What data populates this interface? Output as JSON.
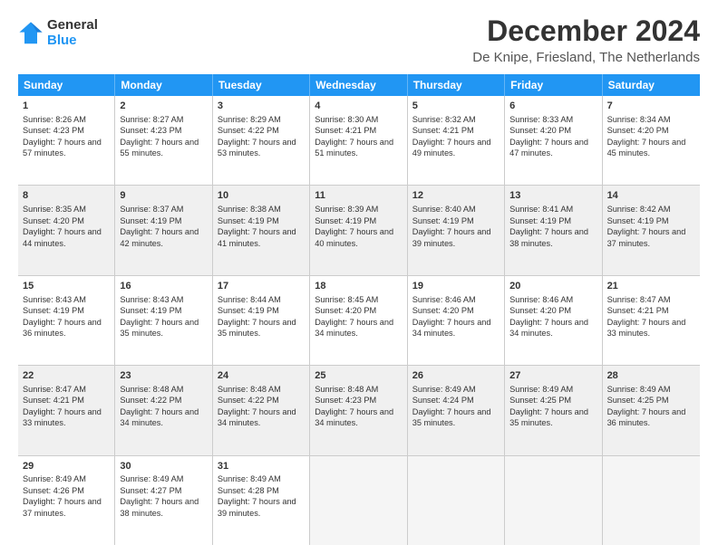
{
  "logo": {
    "general": "General",
    "blue": "Blue"
  },
  "title": "December 2024",
  "subtitle": "De Knipe, Friesland, The Netherlands",
  "days": [
    "Sunday",
    "Monday",
    "Tuesday",
    "Wednesday",
    "Thursday",
    "Friday",
    "Saturday"
  ],
  "weeks": [
    [
      {
        "day": 1,
        "sunrise": "Sunrise: 8:26 AM",
        "sunset": "Sunset: 4:23 PM",
        "daylight": "Daylight: 7 hours and 57 minutes."
      },
      {
        "day": 2,
        "sunrise": "Sunrise: 8:27 AM",
        "sunset": "Sunset: 4:23 PM",
        "daylight": "Daylight: 7 hours and 55 minutes."
      },
      {
        "day": 3,
        "sunrise": "Sunrise: 8:29 AM",
        "sunset": "Sunset: 4:22 PM",
        "daylight": "Daylight: 7 hours and 53 minutes."
      },
      {
        "day": 4,
        "sunrise": "Sunrise: 8:30 AM",
        "sunset": "Sunset: 4:21 PM",
        "daylight": "Daylight: 7 hours and 51 minutes."
      },
      {
        "day": 5,
        "sunrise": "Sunrise: 8:32 AM",
        "sunset": "Sunset: 4:21 PM",
        "daylight": "Daylight: 7 hours and 49 minutes."
      },
      {
        "day": 6,
        "sunrise": "Sunrise: 8:33 AM",
        "sunset": "Sunset: 4:20 PM",
        "daylight": "Daylight: 7 hours and 47 minutes."
      },
      {
        "day": 7,
        "sunrise": "Sunrise: 8:34 AM",
        "sunset": "Sunset: 4:20 PM",
        "daylight": "Daylight: 7 hours and 45 minutes."
      }
    ],
    [
      {
        "day": 8,
        "sunrise": "Sunrise: 8:35 AM",
        "sunset": "Sunset: 4:20 PM",
        "daylight": "Daylight: 7 hours and 44 minutes."
      },
      {
        "day": 9,
        "sunrise": "Sunrise: 8:37 AM",
        "sunset": "Sunset: 4:19 PM",
        "daylight": "Daylight: 7 hours and 42 minutes."
      },
      {
        "day": 10,
        "sunrise": "Sunrise: 8:38 AM",
        "sunset": "Sunset: 4:19 PM",
        "daylight": "Daylight: 7 hours and 41 minutes."
      },
      {
        "day": 11,
        "sunrise": "Sunrise: 8:39 AM",
        "sunset": "Sunset: 4:19 PM",
        "daylight": "Daylight: 7 hours and 40 minutes."
      },
      {
        "day": 12,
        "sunrise": "Sunrise: 8:40 AM",
        "sunset": "Sunset: 4:19 PM",
        "daylight": "Daylight: 7 hours and 39 minutes."
      },
      {
        "day": 13,
        "sunrise": "Sunrise: 8:41 AM",
        "sunset": "Sunset: 4:19 PM",
        "daylight": "Daylight: 7 hours and 38 minutes."
      },
      {
        "day": 14,
        "sunrise": "Sunrise: 8:42 AM",
        "sunset": "Sunset: 4:19 PM",
        "daylight": "Daylight: 7 hours and 37 minutes."
      }
    ],
    [
      {
        "day": 15,
        "sunrise": "Sunrise: 8:43 AM",
        "sunset": "Sunset: 4:19 PM",
        "daylight": "Daylight: 7 hours and 36 minutes."
      },
      {
        "day": 16,
        "sunrise": "Sunrise: 8:43 AM",
        "sunset": "Sunset: 4:19 PM",
        "daylight": "Daylight: 7 hours and 35 minutes."
      },
      {
        "day": 17,
        "sunrise": "Sunrise: 8:44 AM",
        "sunset": "Sunset: 4:19 PM",
        "daylight": "Daylight: 7 hours and 35 minutes."
      },
      {
        "day": 18,
        "sunrise": "Sunrise: 8:45 AM",
        "sunset": "Sunset: 4:20 PM",
        "daylight": "Daylight: 7 hours and 34 minutes."
      },
      {
        "day": 19,
        "sunrise": "Sunrise: 8:46 AM",
        "sunset": "Sunset: 4:20 PM",
        "daylight": "Daylight: 7 hours and 34 minutes."
      },
      {
        "day": 20,
        "sunrise": "Sunrise: 8:46 AM",
        "sunset": "Sunset: 4:20 PM",
        "daylight": "Daylight: 7 hours and 34 minutes."
      },
      {
        "day": 21,
        "sunrise": "Sunrise: 8:47 AM",
        "sunset": "Sunset: 4:21 PM",
        "daylight": "Daylight: 7 hours and 33 minutes."
      }
    ],
    [
      {
        "day": 22,
        "sunrise": "Sunrise: 8:47 AM",
        "sunset": "Sunset: 4:21 PM",
        "daylight": "Daylight: 7 hours and 33 minutes."
      },
      {
        "day": 23,
        "sunrise": "Sunrise: 8:48 AM",
        "sunset": "Sunset: 4:22 PM",
        "daylight": "Daylight: 7 hours and 34 minutes."
      },
      {
        "day": 24,
        "sunrise": "Sunrise: 8:48 AM",
        "sunset": "Sunset: 4:22 PM",
        "daylight": "Daylight: 7 hours and 34 minutes."
      },
      {
        "day": 25,
        "sunrise": "Sunrise: 8:48 AM",
        "sunset": "Sunset: 4:23 PM",
        "daylight": "Daylight: 7 hours and 34 minutes."
      },
      {
        "day": 26,
        "sunrise": "Sunrise: 8:49 AM",
        "sunset": "Sunset: 4:24 PM",
        "daylight": "Daylight: 7 hours and 35 minutes."
      },
      {
        "day": 27,
        "sunrise": "Sunrise: 8:49 AM",
        "sunset": "Sunset: 4:25 PM",
        "daylight": "Daylight: 7 hours and 35 minutes."
      },
      {
        "day": 28,
        "sunrise": "Sunrise: 8:49 AM",
        "sunset": "Sunset: 4:25 PM",
        "daylight": "Daylight: 7 hours and 36 minutes."
      }
    ],
    [
      {
        "day": 29,
        "sunrise": "Sunrise: 8:49 AM",
        "sunset": "Sunset: 4:26 PM",
        "daylight": "Daylight: 7 hours and 37 minutes."
      },
      {
        "day": 30,
        "sunrise": "Sunrise: 8:49 AM",
        "sunset": "Sunset: 4:27 PM",
        "daylight": "Daylight: 7 hours and 38 minutes."
      },
      {
        "day": 31,
        "sunrise": "Sunrise: 8:49 AM",
        "sunset": "Sunset: 4:28 PM",
        "daylight": "Daylight: 7 hours and 39 minutes."
      },
      null,
      null,
      null,
      null
    ]
  ]
}
